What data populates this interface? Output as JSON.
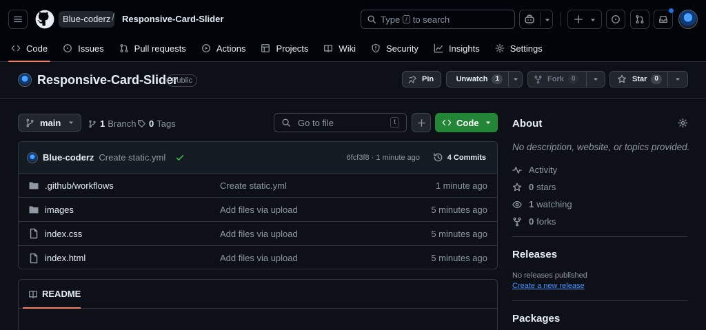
{
  "header": {
    "owner": "Blue-coderz",
    "separator": "/",
    "repo": "Responsive-Card-Slider",
    "search": {
      "prefix": "Type",
      "key": "/",
      "suffix": "to search"
    }
  },
  "tabs": [
    {
      "label": "Code",
      "icon": "code-icon",
      "active": true
    },
    {
      "label": "Issues",
      "icon": "issue-icon"
    },
    {
      "label": "Pull requests",
      "icon": "pull-request-icon"
    },
    {
      "label": "Actions",
      "icon": "play-icon"
    },
    {
      "label": "Projects",
      "icon": "table-icon"
    },
    {
      "label": "Wiki",
      "icon": "book-icon"
    },
    {
      "label": "Security",
      "icon": "shield-icon"
    },
    {
      "label": "Insights",
      "icon": "graph-icon"
    },
    {
      "label": "Settings",
      "icon": "gear-icon"
    }
  ],
  "repo_header": {
    "name": "Responsive-Card-Slider",
    "visibility": "Public",
    "pin": "Pin",
    "watch": {
      "label": "Unwatch",
      "count": "1"
    },
    "fork": {
      "label": "Fork",
      "count": "0"
    },
    "star": {
      "label": "Star",
      "count": "0"
    }
  },
  "toolbar": {
    "branch": "main",
    "branches": {
      "count": "1",
      "label": "Branch"
    },
    "tags": {
      "count": "0",
      "label": "Tags"
    },
    "goto_placeholder": "Go to file",
    "goto_key": "t",
    "code_button": "Code"
  },
  "latest_commit": {
    "author": "Blue-coderz",
    "message": "Create static.yml",
    "meta": "6fcf3f8 · 1 minute ago",
    "commits": "4 Commits"
  },
  "files": [
    {
      "type": "folder",
      "name": ".github/workflows",
      "message": "Create static.yml",
      "age": "1 minute ago"
    },
    {
      "type": "folder",
      "name": "images",
      "message": "Add files via upload",
      "age": "5 minutes ago"
    },
    {
      "type": "file",
      "name": "index.css",
      "message": "Add files via upload",
      "age": "5 minutes ago"
    },
    {
      "type": "file",
      "name": "index.html",
      "message": "Add files via upload",
      "age": "5 minutes ago"
    }
  ],
  "readme": {
    "label": "README"
  },
  "about": {
    "title": "About",
    "description": "No description, website, or topics provided.",
    "activity": "Activity",
    "stars": {
      "count": "0",
      "label": "stars"
    },
    "watching": {
      "count": "1",
      "label": "watching"
    },
    "forks": {
      "count": "0",
      "label": "forks"
    }
  },
  "releases": {
    "title": "Releases",
    "none": "No releases published",
    "create": "Create a new release"
  },
  "packages": {
    "title": "Packages"
  },
  "colors": {
    "accent_underline": "#f78166",
    "code_button": "#238636",
    "link": "#4493f8",
    "success": "#3fb950",
    "notification": "#1f6feb"
  }
}
